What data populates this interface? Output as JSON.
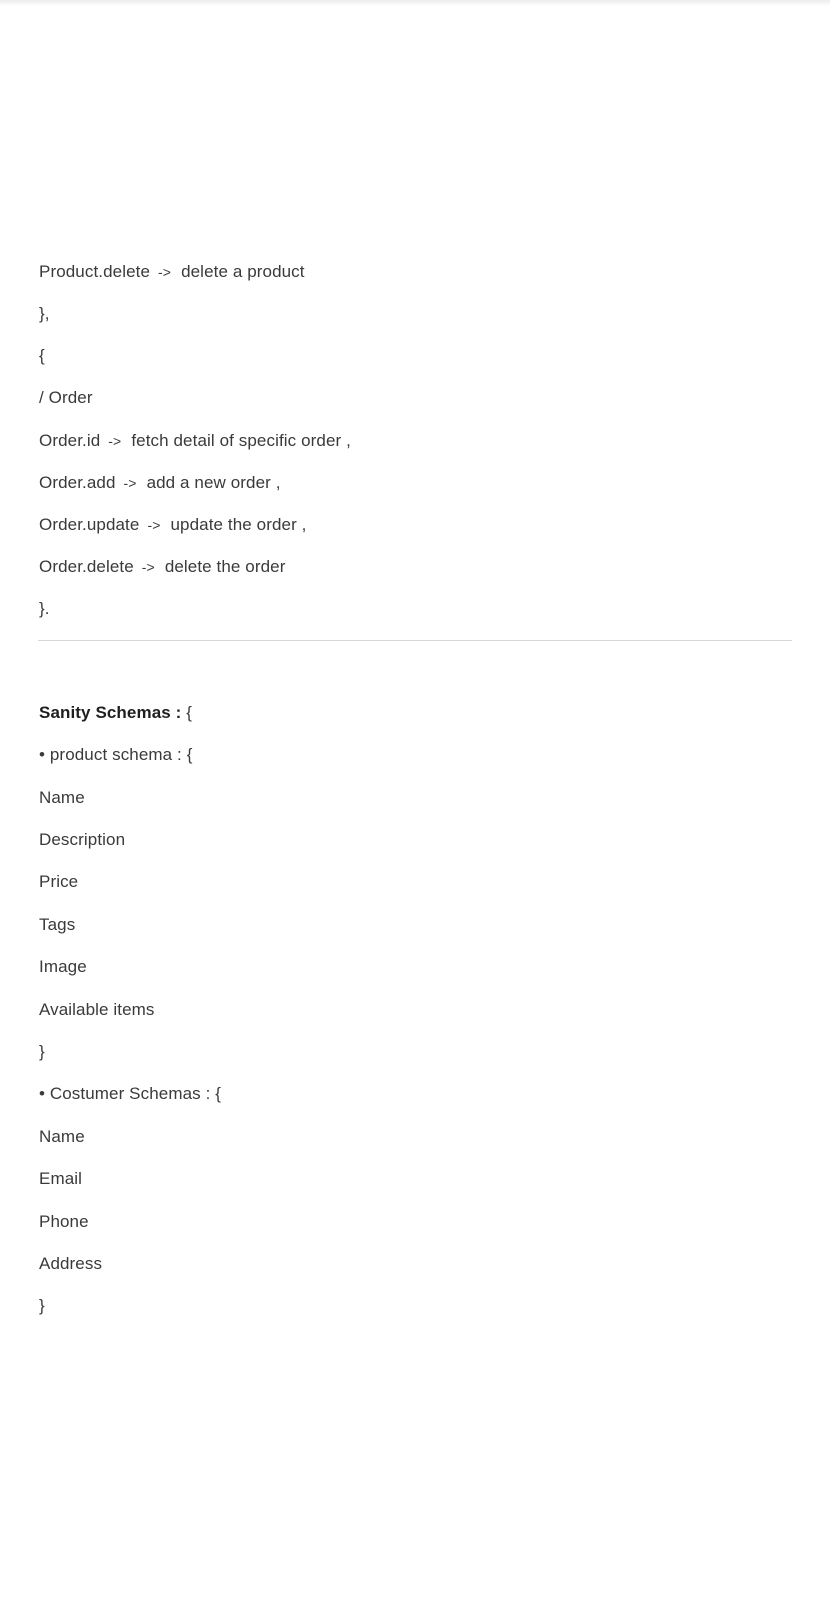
{
  "api_endpoints": {
    "product_delete": {
      "key": "Product.delete",
      "arrow": "->",
      "desc": "delete a product"
    },
    "close_product": "},",
    "open_order": "{",
    "order_heading": "/ Order",
    "order_id": {
      "key": "Order.id",
      "arrow": "->",
      "desc": "fetch detail of specific order ,"
    },
    "order_add": {
      "key": "Order.add",
      "arrow": "->",
      "desc": "add a new order ,"
    },
    "order_update": {
      "key": "Order.update",
      "arrow": "->",
      "desc": "update the order ,"
    },
    "order_delete": {
      "key": "Order.delete",
      "arrow": "->",
      "desc": "delete the order"
    },
    "close_order": "}."
  },
  "schemas": {
    "heading_bold": "Sanity Schemas :",
    "heading_brace": " {",
    "product": {
      "title": "• product schema : {",
      "fields": [
        "Name",
        "Description",
        "Price",
        "Tags",
        "Image",
        "Available items"
      ],
      "close": "}"
    },
    "customer": {
      "title": "• Costumer Schemas : {",
      "fields": [
        "Name",
        "Email",
        "Phone",
        "Address"
      ],
      "close": "}"
    }
  }
}
